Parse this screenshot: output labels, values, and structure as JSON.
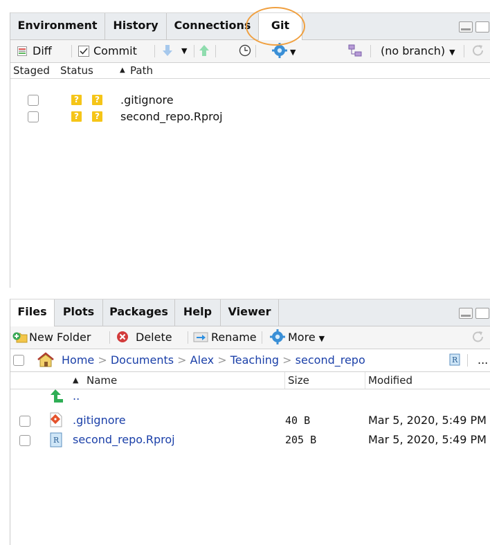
{
  "git_pane": {
    "tabs": [
      "Environment",
      "History",
      "Connections",
      "Git"
    ],
    "active_tab": "Git",
    "toolbar": {
      "diff_label": "Diff",
      "commit_label": "Commit",
      "branch_label": "(no branch)"
    },
    "columns": {
      "staged": "Staged",
      "status": "Status",
      "path": "Path"
    },
    "files": [
      {
        "status": [
          "?",
          "?"
        ],
        "path": ".gitignore"
      },
      {
        "status": [
          "?",
          "?"
        ],
        "path": "second_repo.Rproj"
      }
    ],
    "badge_color": "#f5c518"
  },
  "files_pane": {
    "tabs": [
      "Files",
      "Plots",
      "Packages",
      "Help",
      "Viewer"
    ],
    "active_tab": "Files",
    "toolbar": {
      "new_folder_label": "New Folder",
      "delete_label": "Delete",
      "rename_label": "Rename",
      "more_label": "More"
    },
    "breadcrumb": [
      "Home",
      "Documents",
      "Alex",
      "Teaching",
      "second_repo"
    ],
    "breadcrumb_more": "...",
    "columns": {
      "name": "Name",
      "size": "Size",
      "modified": "Modified"
    },
    "parent_dir": "..",
    "files": [
      {
        "name": ".gitignore",
        "size": "40 B",
        "modified": "Mar 5, 2020, 5:49 PM",
        "icon": "git-file-icon"
      },
      {
        "name": "second_repo.Rproj",
        "size": "205 B",
        "modified": "Mar 5, 2020, 5:49 PM",
        "icon": "rproj-file-icon"
      }
    ],
    "link_color": "#1a3fa8"
  },
  "highlight_color": "#f0a040"
}
